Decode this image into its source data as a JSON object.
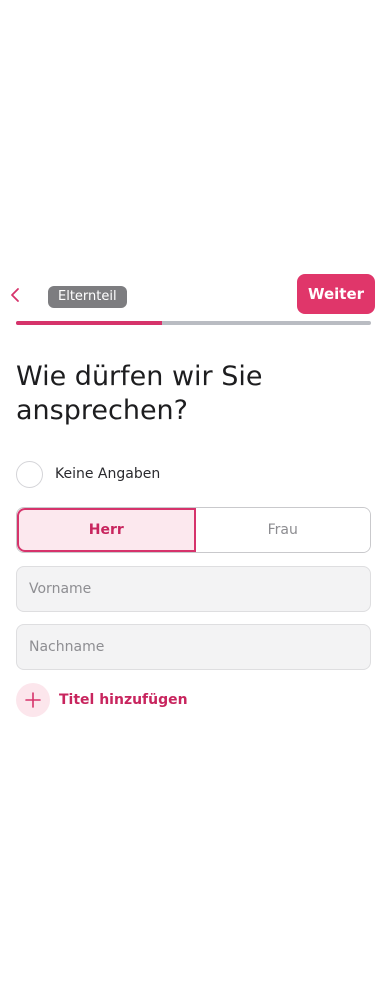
{
  "header": {
    "back_icon": "chevron-left-icon",
    "role_label": "Elternteil",
    "next_label": "Weiter"
  },
  "progress": {
    "value": 0.41
  },
  "main": {
    "title": "Wie dürfen wir Sie ansprechen?",
    "no_info_label": "Keine Angaben",
    "salutation_options": [
      "Herr",
      "Frau"
    ],
    "selected_salutation": "Herr",
    "first_name_placeholder": "Vorname",
    "last_name_placeholder": "Nachname",
    "add_title_label": "Titel hinzufügen",
    "add_title_icon": "plus-icon"
  },
  "colors": {
    "accent": "#e0366a",
    "accent_text": "#c8255e",
    "accent_light": "#fce8ee",
    "badge": "#7d7d80",
    "track": "#b9bcc2"
  }
}
